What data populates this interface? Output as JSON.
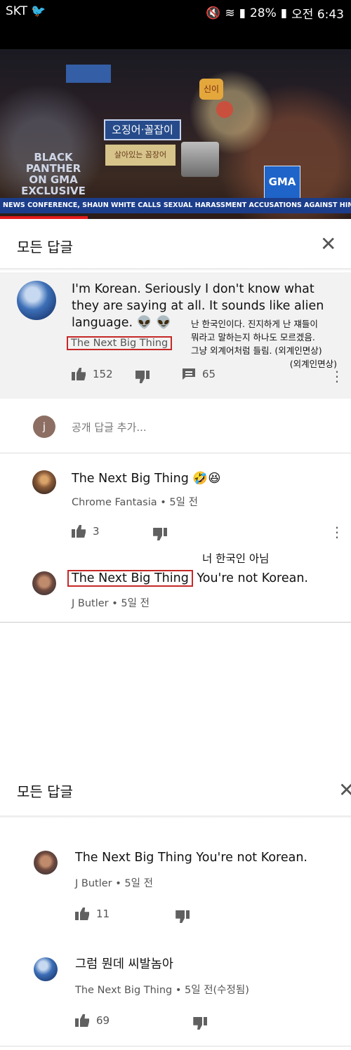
{
  "status_bar": {
    "carrier": "SKT",
    "battery": "28%",
    "time": "오전 6:43"
  },
  "video": {
    "sign_main": "오징어·꼴잡이",
    "sign_sub": "살아있는 꼼장어",
    "sign_small": "신이",
    "overlay_brand": "BLACK PANTHER ON GMA EXCLUSIVE",
    "gma_badge": "GMA",
    "ticker": "NEWS CONFERENCE, SHAUN WHITE CALLS SEXUAL HARASSMENT ACCUSATIONS AGAINST HIM \"GOS",
    "progress_fraction": 0.25
  },
  "panel1": {
    "title": "모든 답글"
  },
  "main_comment": {
    "text": "I'm Korean. Seriously I don't know what they are saying at all.  It sounds like alien language.",
    "emoji": "👽 👽",
    "author": "The Next Big Thing",
    "likes": "152",
    "replies": "65",
    "translation_line1": "난 한국인이다. 진지하게 난 쟤들이",
    "translation_line2": "뭐라고 말하는지 하나도 모르겠음.",
    "translation_line3": "그냥 외계어처럼 들림. (외계인면상)",
    "translation_line4": "(외계인면상)"
  },
  "add_reply": {
    "avatar_letter": "j",
    "placeholder": "공개 답글 추가..."
  },
  "reply1": {
    "text": "The Next Big Thing",
    "emoji": "🤣😆",
    "author": "Chrome Fantasia",
    "time": "5일 전",
    "likes": "3"
  },
  "reply2": {
    "annotation": "너 한국인 아님",
    "mention": "The Next Big Thing",
    "text": " You're not Korean.",
    "author": "J Butler",
    "time": "5일 전"
  },
  "panel2": {
    "title": "모든 답글"
  },
  "reply3": {
    "text": "The Next Big Thing You're not Korean.",
    "author": "J Butler",
    "time": "5일 전",
    "likes": "11"
  },
  "reply4": {
    "text": "그럼 뭔데 씨발놈아",
    "author": "The Next Big Thing",
    "time": "5일 전(수정됨)",
    "likes": "69"
  },
  "colors": {
    "accent_red": "#c62828",
    "progress_red": "#e41b1b",
    "icon_gray": "#606060"
  }
}
